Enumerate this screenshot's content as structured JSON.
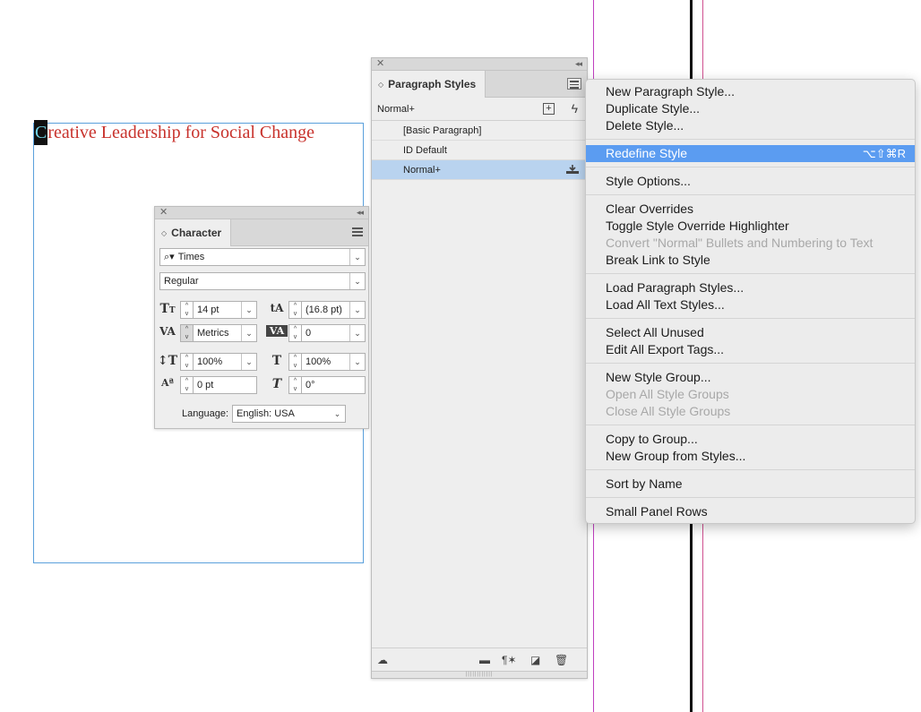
{
  "document": {
    "headline_first_char": "C",
    "headline_rest": "reative Leadership for Social Change"
  },
  "paragraph_styles_panel": {
    "tab_label": "Paragraph Styles",
    "current_style": "Normal+",
    "styles": [
      {
        "label": "[Basic Paragraph]",
        "selected": false
      },
      {
        "label": "ID Default",
        "selected": false
      },
      {
        "label": "Normal+",
        "selected": true
      }
    ],
    "bottom_icons": [
      "cc-library-icon",
      "folder-icon",
      "clear-overrides-icon",
      "new-style-icon",
      "trash-icon"
    ]
  },
  "character_panel": {
    "tab_label": "Character",
    "font_family": "Times",
    "font_style": "Regular",
    "font_size": "14 pt",
    "leading": "(16.8 pt)",
    "kerning": "Metrics",
    "tracking": "0",
    "vertical_scale": "100%",
    "horizontal_scale": "100%",
    "baseline_shift": "0 pt",
    "skew": "0°",
    "language_label": "Language:",
    "language": "English: USA"
  },
  "context_menu": {
    "groups": [
      [
        {
          "label": "New Paragraph Style...",
          "enabled": true
        },
        {
          "label": "Duplicate Style...",
          "enabled": true
        },
        {
          "label": "Delete Style...",
          "enabled": true
        }
      ],
      [
        {
          "label": "Redefine Style",
          "enabled": true,
          "highlighted": true,
          "shortcut": "⌥⇧⌘R"
        }
      ],
      [
        {
          "label": "Style Options...",
          "enabled": true
        }
      ],
      [
        {
          "label": "Clear Overrides",
          "enabled": true
        },
        {
          "label": "Toggle Style Override Highlighter",
          "enabled": true
        },
        {
          "label": "Convert \"Normal\" Bullets and Numbering to Text",
          "enabled": false
        },
        {
          "label": "Break Link to Style",
          "enabled": true
        }
      ],
      [
        {
          "label": "Load Paragraph Styles...",
          "enabled": true
        },
        {
          "label": "Load All Text Styles...",
          "enabled": true
        }
      ],
      [
        {
          "label": "Select All Unused",
          "enabled": true
        },
        {
          "label": "Edit All Export Tags...",
          "enabled": true
        }
      ],
      [
        {
          "label": "New Style Group...",
          "enabled": true
        },
        {
          "label": "Open All Style Groups",
          "enabled": false
        },
        {
          "label": "Close All Style Groups",
          "enabled": false
        }
      ],
      [
        {
          "label": "Copy to Group...",
          "enabled": true
        },
        {
          "label": "New Group from Styles...",
          "enabled": true
        }
      ],
      [
        {
          "label": "Sort by Name",
          "enabled": true
        }
      ],
      [
        {
          "label": "Small Panel Rows",
          "enabled": true
        }
      ]
    ]
  },
  "colors": {
    "headline": "#c8322c",
    "frame": "#5aa0dc",
    "menu_highlight": "#5b9cf1",
    "selected_row": "#b9d3ef"
  }
}
